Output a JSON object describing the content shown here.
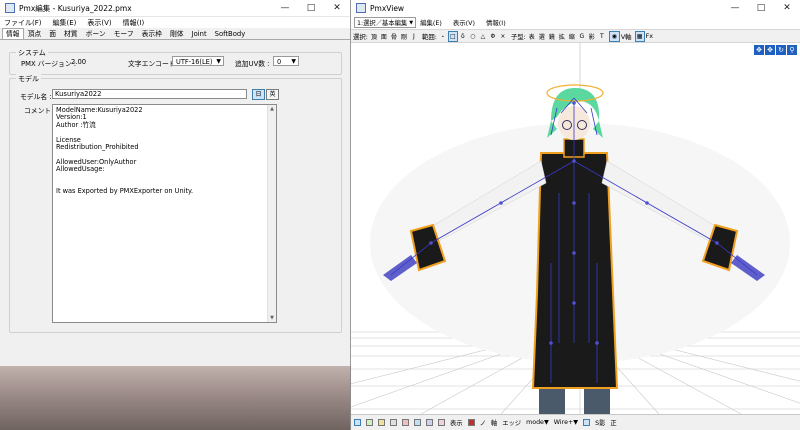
{
  "left": {
    "title": "Pmx編集 - Kusuriya_2022.pmx",
    "menu": [
      "ファイル(F)",
      "編集(E)",
      "表示(V)",
      "情報(I)"
    ],
    "tabs": [
      "情報",
      "頂点",
      "面",
      "材質",
      "ボーン",
      "モーフ",
      "表示枠",
      "剛体",
      "Joint",
      "SoftBody"
    ],
    "system": {
      "group_label": "システム",
      "version_label": "PMX バージョン :",
      "version_value": "2.00",
      "encoding_label": "文字エンコード :",
      "encoding_value": "UTF-16(LE)",
      "uv_label": "追加UV数 :",
      "uv_value": "0"
    },
    "model": {
      "group_label": "モデル",
      "name_label": "モデル名 :",
      "name_value": "Kusuriya2022",
      "lang_ja": "日",
      "lang_en": "英",
      "comment_label": "コメント :",
      "comment_lines": [
        "ModelName:Kusuriya2022",
        "Version:1",
        "Author :竹流",
        "",
        "License",
        "Redistribution_Prohibited",
        "",
        "AllowedUser:OnlyAuthor",
        "AllowedUsage:",
        "",
        "",
        "It was Exported by PMXExporter on Unity."
      ]
    }
  },
  "right": {
    "title": "PmxView",
    "menu": [
      "1:選択／基本編集",
      "編集(E)",
      "表示(V)",
      "情報(I)"
    ],
    "toolbar": {
      "select_label": "選択:",
      "select_items": [
        "頂",
        "面",
        "骨",
        "剛",
        "J"
      ],
      "range_label": "範囲:",
      "range_items": [
        "・",
        "□",
        "δ",
        "○",
        "△",
        "Φ",
        "×"
      ],
      "kp_label": "子型:",
      "kp_items": [
        "表",
        "選",
        "鏡",
        "拡",
        "縮",
        "G",
        "影",
        "T"
      ],
      "v_label": "V軸",
      "fx_label": "Fx"
    },
    "status": {
      "items": [
        "表示",
        "ノ",
        "軸",
        "エッジ"
      ],
      "mode_label": "mode",
      "wire_label": "Wire+",
      "shadow_label": "S影",
      "right_label": "正"
    }
  },
  "colors": {
    "accent": "#3c7fb1",
    "bone_blue": "#3838c8",
    "hair_green": "#5ad8a0",
    "trim_orange": "#f0a020"
  }
}
